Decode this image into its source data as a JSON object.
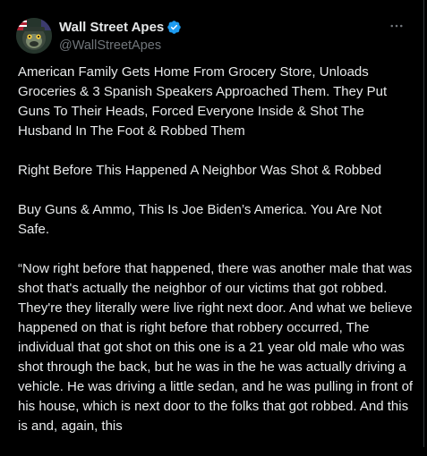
{
  "author": {
    "display_name": "Wall Street Apes",
    "handle": "@WallStreetApes",
    "avatar_icon": "ape-avatar-icon",
    "verified_icon": "verified-badge-icon",
    "verified_color": "#1d9bf0"
  },
  "more_icon": "more-dots-icon",
  "tweet": {
    "paragraphs": [
      "American Family Gets Home From Grocery Store, Unloads Groceries & 3 Spanish Speakers Approached Them. They Put Guns To Their Heads, Forced Everyone Inside & Shot The Husband In The Foot & Robbed Them",
      "Right Before This Happened A Neighbor Was Shot & Robbed",
      "Buy Guns & Ammo, This Is Joe Biden’s America. You Are Not Safe.",
      "“Now right before that happened, there was another male that was shot that's actually the neighbor of our victims that got robbed. They're they literally were live right next door. And what we believe happened on that is right before that robbery occurred, The individual that got shot on this one is a 21 year old male who was shot through the back, but he was in the he was actually driving a vehicle. He was driving a little sedan, and he was pulling in front of his house, which is next door to the folks that got robbed. And this is and, again, this"
    ]
  },
  "colors": {
    "background": "#000000",
    "text": "#e7e9ea",
    "secondary_text": "#71767b",
    "border": "#2f3336"
  }
}
